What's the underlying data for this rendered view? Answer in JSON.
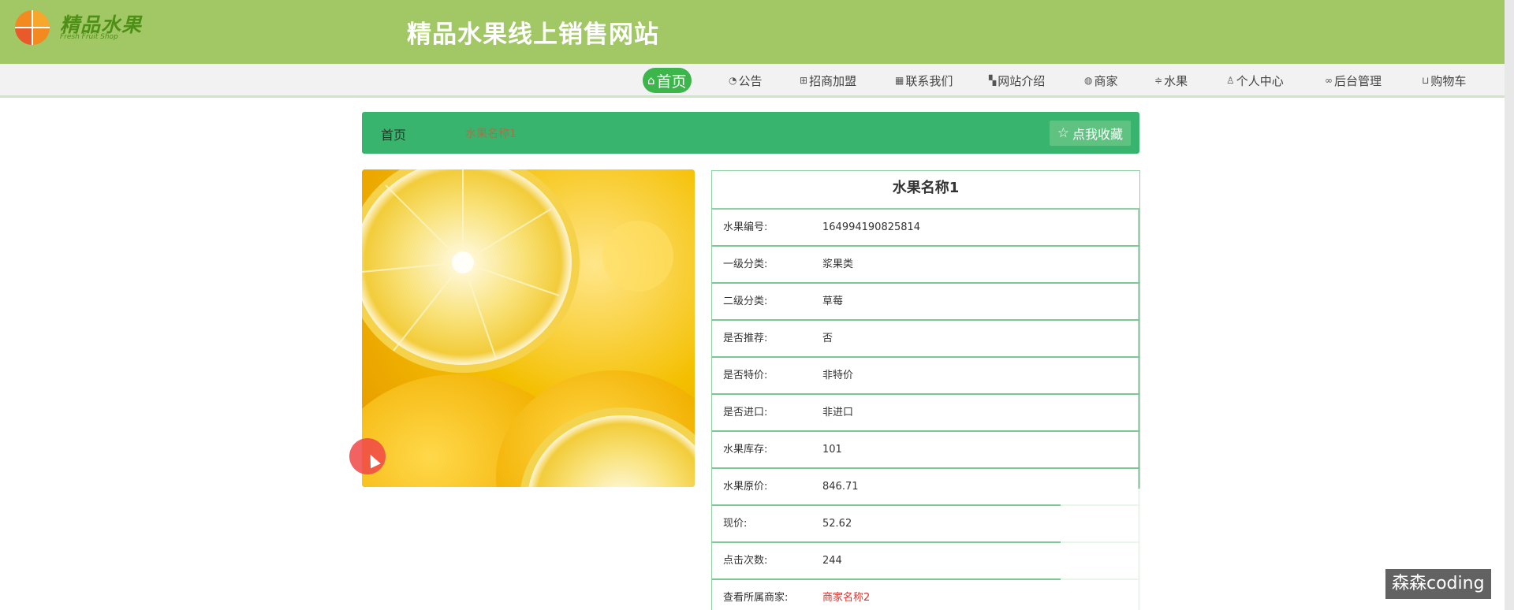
{
  "header": {
    "logo_text": "精品水果",
    "logo_sub": "Fresh Fruit Shop",
    "site_title": "精品水果线上销售网站"
  },
  "nav": {
    "items": [
      {
        "label": "首页",
        "icon": "home-icon",
        "active": true
      },
      {
        "label": "公告",
        "icon": "gauge-icon"
      },
      {
        "label": "招商加盟",
        "icon": "grid-icon"
      },
      {
        "label": "联系我们",
        "icon": "table-icon"
      },
      {
        "label": "网站介绍",
        "icon": "apps-icon"
      },
      {
        "label": "商家",
        "icon": "palette-icon"
      },
      {
        "label": "水果",
        "icon": "sliders-icon"
      },
      {
        "label": "个人中心",
        "icon": "user-icon"
      },
      {
        "label": "后台管理",
        "icon": "link-icon"
      },
      {
        "label": "购物车",
        "icon": "cart-icon"
      }
    ]
  },
  "breadcrumb": {
    "home": "首页",
    "current": "水果名称1"
  },
  "favorite_button": {
    "label": "点我收藏",
    "icon": "star-icon"
  },
  "detail": {
    "title": "水果名称1",
    "rows": [
      {
        "label": "水果编号:",
        "value": "164994190825814"
      },
      {
        "label": "一级分类:",
        "value": "浆果类"
      },
      {
        "label": "二级分类:",
        "value": "草莓"
      },
      {
        "label": "是否推荐:",
        "value": "否"
      },
      {
        "label": "是否特价:",
        "value": "非特价"
      },
      {
        "label": "是否进口:",
        "value": "非进口"
      },
      {
        "label": "水果库存:",
        "value": "101"
      },
      {
        "label": "水果原价:",
        "value": "846.71"
      },
      {
        "label": "现价:",
        "value": "52.62"
      },
      {
        "label": "点击次数:",
        "value": "244"
      },
      {
        "label": "查看所属商家:",
        "value": "商家名称2",
        "link": true
      }
    ]
  },
  "watermark": "森森coding",
  "colors": {
    "header_bg": "#a2c866",
    "accent_green": "#38b46f",
    "nav_active": "#3cb54a",
    "link_red": "#e0302a"
  }
}
